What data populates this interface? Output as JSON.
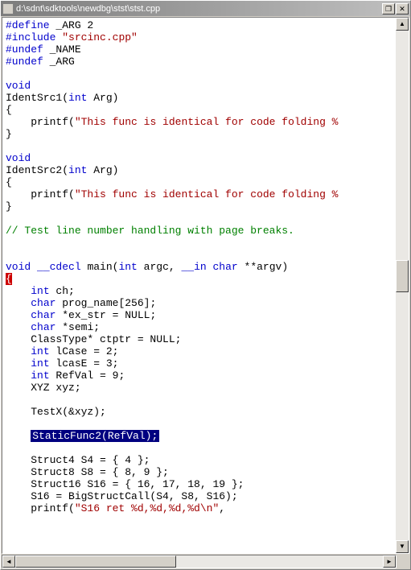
{
  "titlebar": {
    "path": "d:\\sdnt\\sdktools\\newdbg\\stst\\stst.cpp",
    "restore": "❐",
    "close": "✕"
  },
  "code": {
    "l1_a": "#define",
    "l1_b": " _ARG 2",
    "l2_a": "#include",
    "l2_b": " ",
    "l2_c": "\"srcinc.cpp\"",
    "l3_a": "#undef",
    "l3_b": " _NAME",
    "l4_a": "#undef",
    "l4_b": " _ARG",
    "l5": "",
    "l6": "void",
    "l7_a": "IdentSrc1(",
    "l7_b": "int",
    "l7_c": " Arg)",
    "l8": "{",
    "l9_a": "    printf(",
    "l9_b": "\"This func is identical for code folding %",
    "l10": "}",
    "l11": "",
    "l12": "void",
    "l13_a": "IdentSrc2(",
    "l13_b": "int",
    "l13_c": " Arg)",
    "l14": "{",
    "l15_a": "    printf(",
    "l15_b": "\"This func is identical for code folding %",
    "l16": "}",
    "l17": "",
    "l18": "// Test line number handling with page breaks.",
    "l19": "",
    "l20": "",
    "l21_a": "void",
    "l21_b": " ",
    "l21_c": "__cdecl",
    "l21_d": " main(",
    "l21_e": "int",
    "l21_f": " argc, ",
    "l21_g": "__in",
    "l21_h": " ",
    "l21_i": "char",
    "l21_j": " **argv)",
    "l22": "{",
    "l23_a": "    ",
    "l23_b": "int",
    "l23_c": " ch;",
    "l24_a": "    ",
    "l24_b": "char",
    "l24_c": " prog_name[256];",
    "l25_a": "    ",
    "l25_b": "char",
    "l25_c": " *ex_str = NULL;",
    "l26_a": "    ",
    "l26_b": "char",
    "l26_c": " *semi;",
    "l27": "    ClassType* ctptr = NULL;",
    "l28_a": "    ",
    "l28_b": "int",
    "l28_c": " lCase = 2;",
    "l29_a": "    ",
    "l29_b": "int",
    "l29_c": " lcasE = 3;",
    "l30_a": "    ",
    "l30_b": "int",
    "l30_c": " RefVal = 9;",
    "l31": "    XYZ xyz;",
    "l32": "",
    "l33": "    TestX(&xyz);",
    "l34": "",
    "l35_a": "    ",
    "l35_b": "StaticFunc2(RefVal);",
    "l36": "",
    "l37": "    Struct4 S4 = { 4 };",
    "l38": "    Struct8 S8 = { 8, 9 };",
    "l39": "    Struct16 S16 = { 16, 17, 18, 19 };",
    "l40": "    S16 = BigStructCall(S4, S8, S16);",
    "l41_a": "    printf(",
    "l41_b": "\"S16 ret %d,%d,%d,%d\\n\"",
    "l41_c": ","
  }
}
